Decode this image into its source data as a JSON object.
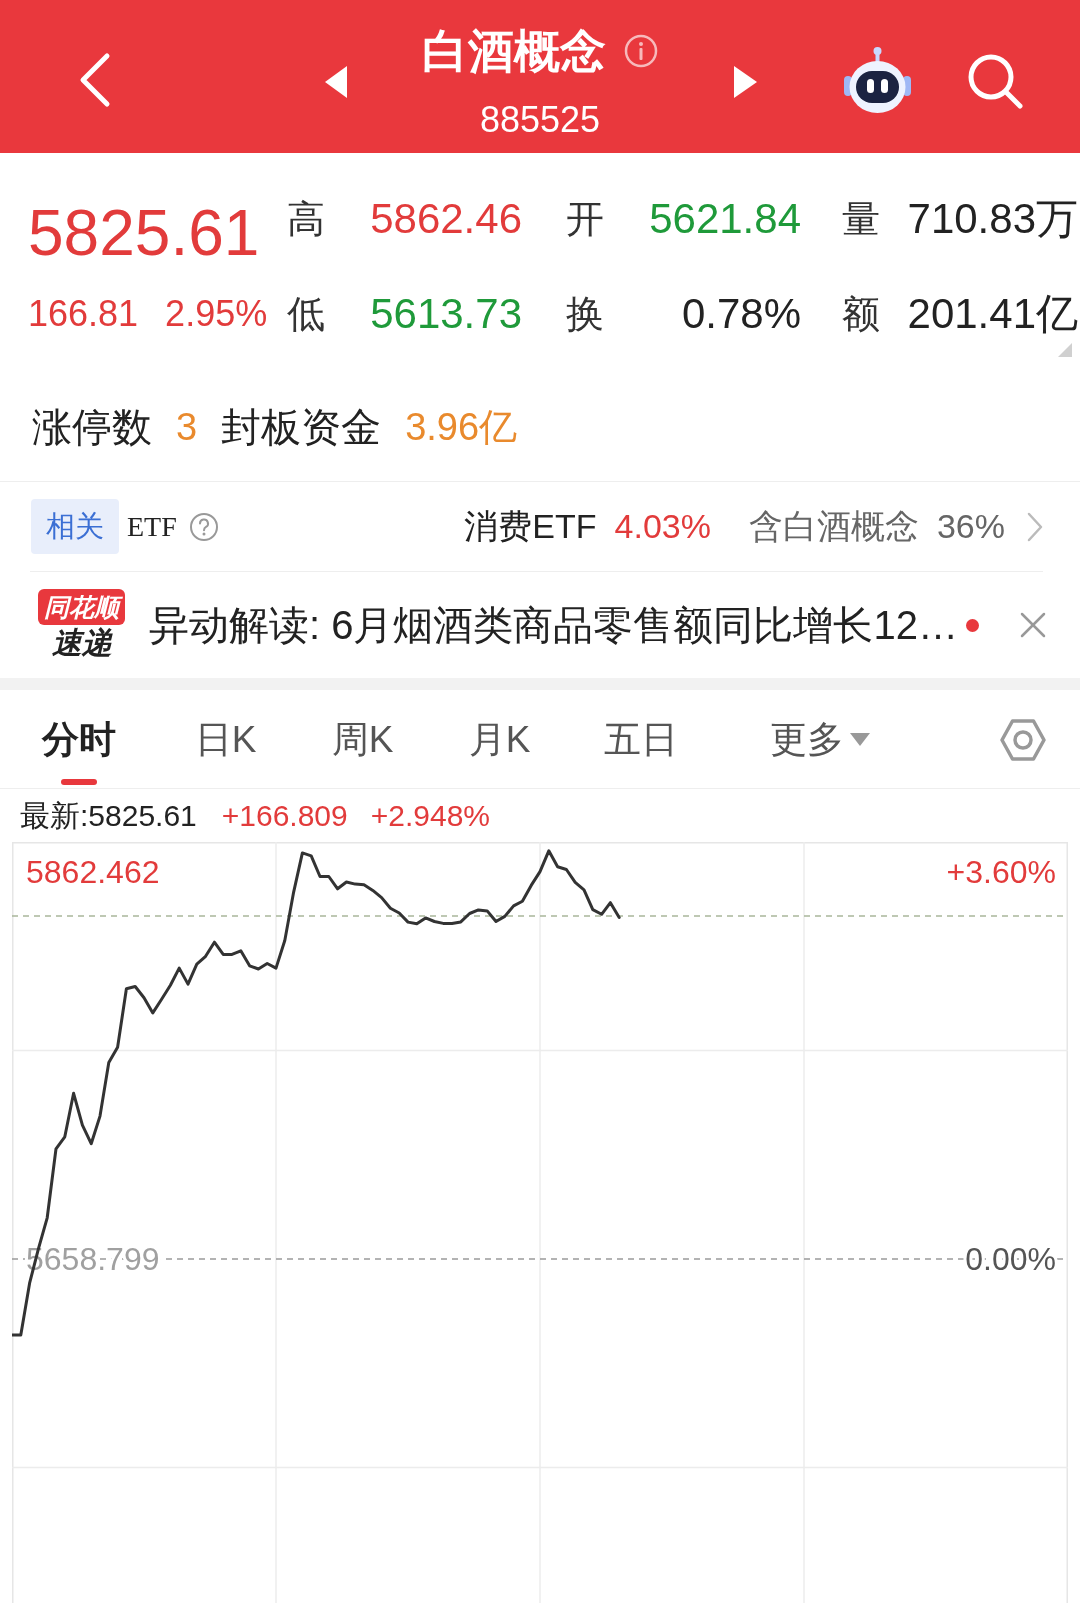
{
  "header": {
    "title": "白酒概念",
    "code": "885525"
  },
  "quote": {
    "price": "5825.61",
    "change": "166.81",
    "change_pct": "2.95%",
    "rising": true,
    "stat_rows": [
      [
        {
          "label": "高",
          "value": "5862.46",
          "color": "#e23b3b"
        },
        {
          "label": "开",
          "value": "5621.84",
          "color": "#1f9a3a"
        },
        {
          "label": "量",
          "value": "710.83万",
          "color": "#222222"
        }
      ],
      [
        {
          "label": "低",
          "value": "5613.73",
          "color": "#1f9a3a"
        },
        {
          "label": "换",
          "value": "0.78%",
          "color": "#222222"
        },
        {
          "label": "额",
          "value": "201.41亿",
          "color": "#222222"
        }
      ]
    ]
  },
  "limit_up": [
    {
      "label": "涨停数",
      "value": "3"
    },
    {
      "label": "封板资金",
      "value": "3.96亿"
    }
  ],
  "related_etf": {
    "tag": "相关",
    "label": "ETF",
    "name": "消费ETF",
    "change": "4.03%",
    "rising": true,
    "holding_label": "含白酒概念",
    "holding_pct": "36%"
  },
  "news": {
    "brand_top": "同花顺",
    "brand_bottom": "速递",
    "text": "异动解读: 6月烟酒类商品零售额同比增长12…",
    "unread": true
  },
  "tabs": [
    {
      "label": "分时",
      "selected": true,
      "kind": "tab"
    },
    {
      "label": "日K",
      "selected": false,
      "kind": "tab"
    },
    {
      "label": "周K",
      "selected": false,
      "kind": "tab"
    },
    {
      "label": "月K",
      "selected": false,
      "kind": "tab"
    },
    {
      "label": "五日",
      "selected": false,
      "kind": "tab"
    },
    {
      "label": "更多",
      "selected": false,
      "kind": "dropdown"
    }
  ],
  "chart": {
    "latest": "最新:5825.61",
    "change": "+166.809",
    "change_pct": "+2.948%",
    "rising": true,
    "right_axis_labels": [
      "+3.60%",
      "0.00%"
    ],
    "chart_data": {
      "type": "line",
      "grid": true,
      "categories": [
        null,
        null,
        null,
        null,
        null,
        null,
        null,
        null,
        null,
        null,
        null,
        null,
        null,
        null,
        null,
        null,
        null,
        null,
        null,
        null,
        null,
        null,
        null,
        null,
        null,
        null,
        null,
        null,
        null,
        null,
        null,
        null,
        null,
        null,
        null,
        null,
        null,
        null,
        null,
        null,
        null,
        null,
        null,
        null,
        null,
        null,
        null,
        null,
        null,
        null,
        null,
        null,
        null,
        null,
        null,
        null,
        null,
        null,
        null,
        null,
        null,
        null,
        null,
        null,
        null,
        null,
        null,
        null,
        null,
        null,
        null,
        null,
        null,
        null,
        null,
        null,
        null,
        null,
        null,
        null,
        null,
        null,
        null,
        null,
        null,
        null,
        null,
        null,
        null,
        null,
        null,
        null,
        null,
        null,
        null,
        null,
        null,
        null,
        null,
        null,
        null,
        null,
        null,
        null,
        null,
        null,
        null,
        null,
        null,
        null,
        null,
        null,
        null,
        null,
        null,
        null,
        null,
        null,
        null,
        null,
        null
      ],
      "series": [
        {
          "color": "#333333",
          "values": [
            5618.9,
            5618.8,
            5646.1,
            5664.2,
            5680.5,
            5716.8,
            5723.1,
            5746.0,
            5729.2,
            5719.5,
            5734.0,
            5762.2,
            5770.2,
            5801.0,
            5802.2,
            5796.3,
            5788.3,
            5795.5,
            5802.9,
            5811.9,
            5803.5,
            5814.0,
            5818.1,
            5825.5,
            5819.1,
            5819.1,
            5821.0,
            5813.1,
            5811.4,
            5814.3,
            5811.9,
            5826.4,
            5851.8,
            5872.5,
            5871.0,
            5860.1,
            5860.1,
            5853.6,
            5857.2,
            5856.1,
            5855.8,
            5852.8,
            5849.0,
            5843.4,
            5840.9,
            5836.1,
            5835.2,
            5838.3,
            5836.4,
            5835.4,
            5835.4,
            5836.2,
            5840.6,
            5842.5,
            5842.0,
            5836.4,
            5839.1,
            5844.6,
            5847.1,
            5855.4,
            5862.7,
            5873.6,
            5865.2,
            5863.8,
            5857.0,
            5853.1,
            5842.7,
            5840.2,
            5846.3,
            5838.5,
            null,
            null,
            null,
            null,
            null,
            null,
            null,
            null,
            null,
            null,
            null,
            null,
            null,
            null,
            null,
            null,
            null,
            null,
            null,
            null,
            null,
            null,
            null,
            null,
            null,
            null,
            null,
            null,
            null,
            null,
            null,
            null,
            null,
            null,
            null,
            null,
            null,
            null,
            null,
            null,
            null,
            null,
            null,
            null,
            null,
            null,
            null,
            null,
            null,
            null,
            null
          ]
        }
      ],
      "ylim": [
        5477.8,
        5878.25
      ],
      "yticks": [
        {
          "value": 5862.462,
          "label": "5862.462"
        },
        {
          "value": 5658.799,
          "label": "5658.799"
        }
      ],
      "ref_lines": [
        {
          "axis": "y",
          "value": 5658.799
        },
        {
          "axis": "y",
          "value": 5839.3
        }
      ]
    }
  }
}
